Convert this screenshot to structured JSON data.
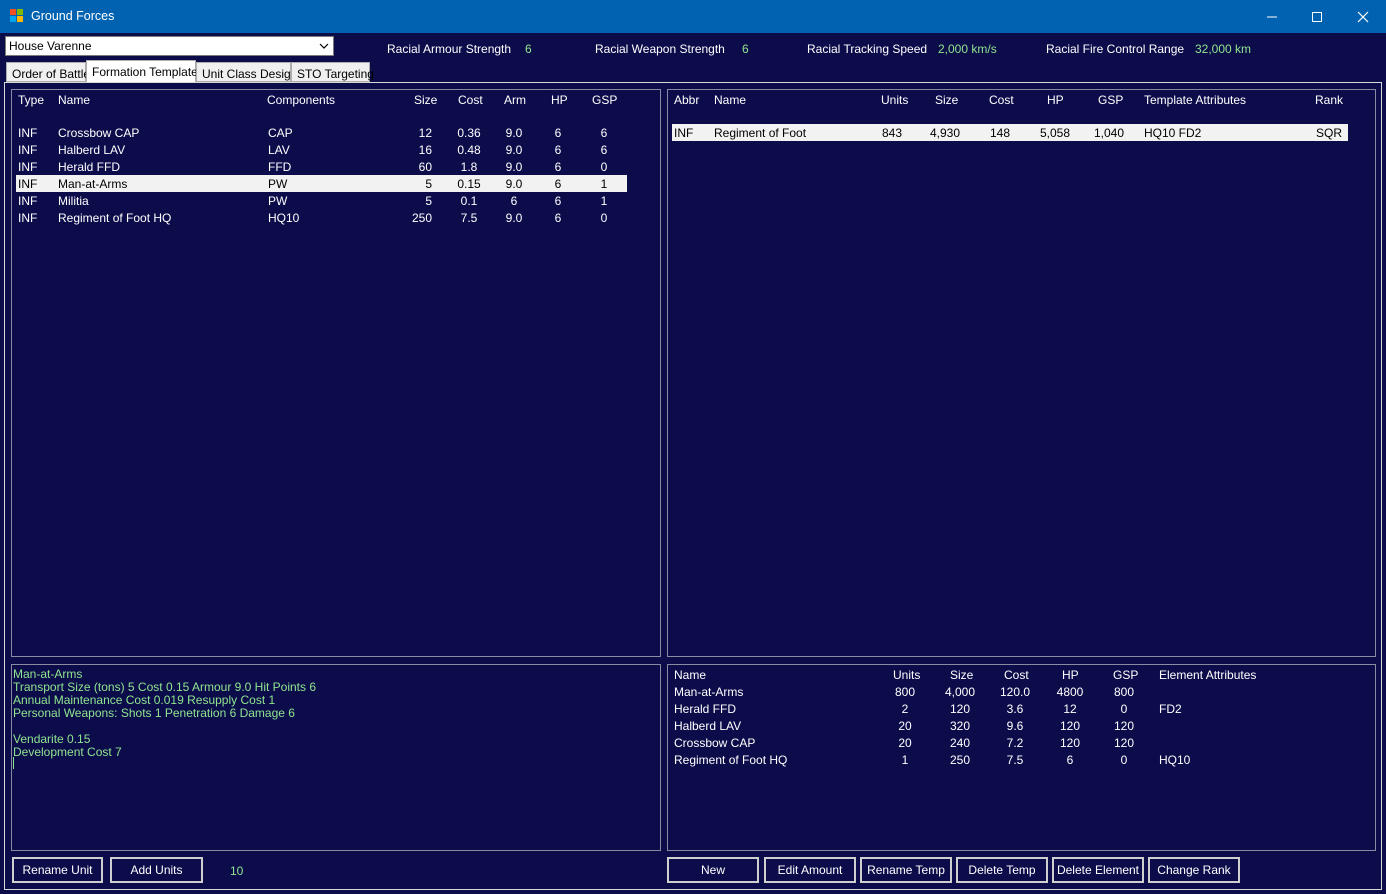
{
  "window": {
    "title": "Ground Forces",
    "colors": {
      "background": "#0c0c4b",
      "titlebar": "#0062b0",
      "value_green": "#8fe58f",
      "selected_row": "#f2f2f2"
    }
  },
  "house_select": {
    "value": "House Varenne"
  },
  "racial_stats": {
    "armour_label": "Racial Armour Strength",
    "armour_value": "6",
    "weapon_label": "Racial Weapon Strength",
    "weapon_value": "6",
    "tracking_label": "Racial Tracking Speed",
    "tracking_value": "2,000 km/s",
    "fire_control_label": "Racial Fire Control Range",
    "fire_control_value": "32,000 km"
  },
  "tabs": [
    "Order of Battle",
    "Formation Templates",
    "Unit Class Design",
    "STO Targeting"
  ],
  "unit_classes": {
    "headers": [
      "Type",
      "Name",
      "Components",
      "Size",
      "Cost",
      "Arm",
      "HP",
      "GSP"
    ],
    "rows": [
      [
        "INF",
        "Crossbow CAP",
        "CAP",
        "12",
        "0.36",
        "9.0",
        "6",
        "6"
      ],
      [
        "INF",
        "Halberd LAV",
        "LAV",
        "16",
        "0.48",
        "9.0",
        "6",
        "6"
      ],
      [
        "INF",
        "Herald FFD",
        "FFD",
        "60",
        "1.8",
        "9.0",
        "6",
        "0"
      ],
      [
        "INF",
        "Man-at-Arms",
        "PW",
        "5",
        "0.15",
        "9.0",
        "6",
        "1"
      ],
      [
        "INF",
        "Militia",
        "PW",
        "5",
        "0.1",
        "6",
        "6",
        "1"
      ],
      [
        "INF",
        "Regiment of Foot HQ",
        "HQ10",
        "250",
        "7.5",
        "9.0",
        "6",
        "0"
      ]
    ]
  },
  "templates": {
    "headers": [
      "Abbr",
      "Name",
      "Units",
      "Size",
      "Cost",
      "HP",
      "GSP",
      "Template Attributes",
      "Rank"
    ],
    "rows": [
      [
        "INF",
        "Regiment of Foot",
        "843",
        "4,930",
        "148",
        "5,058",
        "1,040",
        "HQ10  FD2",
        "SQR"
      ]
    ]
  },
  "unit_info": {
    "lines": [
      "Man-at-Arms",
      "Transport Size (tons)  5    Cost  0.15     Armour  9.0     Hit Points  6",
      "Annual Maintenance Cost  0.019     Resupply Cost  1",
      "Personal Weapons:      Shots 1      Penetration 6      Damage 6",
      "",
      "Vendarite  0.15",
      "Development Cost  7"
    ]
  },
  "elements": {
    "headers": [
      "Name",
      "Units",
      "Size",
      "Cost",
      "HP",
      "GSP",
      "Element Attributes"
    ],
    "rows": [
      [
        "Man-at-Arms",
        "800",
        "4,000",
        "120.0",
        "4800",
        "800",
        ""
      ],
      [
        "Herald FFD",
        "2",
        "120",
        "3.6",
        "12",
        "0",
        "FD2"
      ],
      [
        "Halberd LAV",
        "20",
        "320",
        "9.6",
        "120",
        "120",
        ""
      ],
      [
        "Crossbow CAP",
        "20",
        "240",
        "7.2",
        "120",
        "120",
        ""
      ],
      [
        "Regiment of Foot HQ",
        "1",
        "250",
        "7.5",
        "6",
        "0",
        "HQ10"
      ]
    ]
  },
  "buttons": {
    "rename_unit": "Rename Unit",
    "add_units": "Add Units",
    "add_amount": "10",
    "new": "New",
    "edit_amount": "Edit Amount",
    "rename_temp": "Rename Temp",
    "delete_temp": "Delete Temp",
    "delete_element": "Delete Element",
    "change_rank": "Change Rank"
  }
}
